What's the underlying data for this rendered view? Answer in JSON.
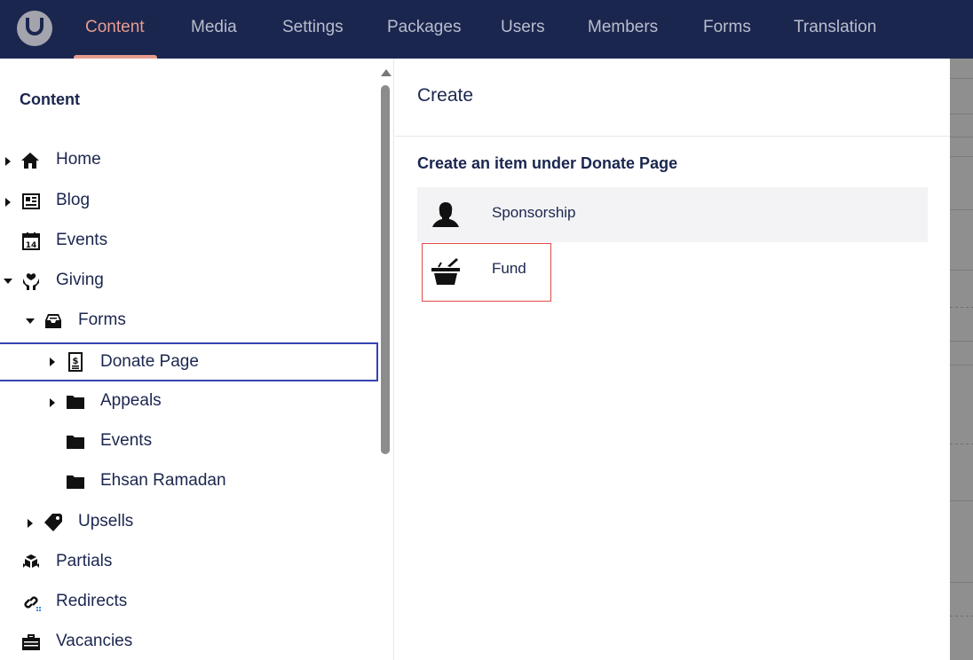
{
  "nav": {
    "logo_icon": "umbraco-logo-icon",
    "items": [
      {
        "label": "Content",
        "active": true
      },
      {
        "label": "Media"
      },
      {
        "label": "Settings"
      },
      {
        "label": "Packages"
      },
      {
        "label": "Users"
      },
      {
        "label": "Members"
      },
      {
        "label": "Forms"
      },
      {
        "label": "Translation"
      }
    ]
  },
  "tree": {
    "heading": "Content",
    "items": [
      {
        "label": "Home",
        "icon": "home-icon",
        "caret": "right"
      },
      {
        "label": "Blog",
        "icon": "newspaper-icon",
        "caret": "right"
      },
      {
        "label": "Events",
        "icon": "calendar-icon",
        "caret": "none"
      },
      {
        "label": "Giving",
        "icon": "hands-heart-icon",
        "caret": "down"
      },
      {
        "label": "Forms",
        "icon": "inbox-icon",
        "caret": "down"
      },
      {
        "label": "Donate Page",
        "icon": "dollar-document-icon",
        "caret": "right",
        "selected": true
      },
      {
        "label": "Appeals",
        "icon": "folder-icon",
        "caret": "right"
      },
      {
        "label": "Events",
        "icon": "folder-icon",
        "caret": "none"
      },
      {
        "label": "Ehsan Ramadan",
        "icon": "folder-icon",
        "caret": "none"
      },
      {
        "label": "Upsells",
        "icon": "tags-icon",
        "caret": "right"
      },
      {
        "label": "Partials",
        "icon": "cubes-icon",
        "caret": "none"
      },
      {
        "label": "Redirects",
        "icon": "link-icon",
        "caret": "none"
      },
      {
        "label": "Vacancies",
        "icon": "briefcase-icon",
        "caret": "none"
      }
    ]
  },
  "create": {
    "title": "Create",
    "subtitle": "Create an item under Donate Page",
    "items": [
      {
        "label": "Sponsorship",
        "icon": "user-female-icon"
      },
      {
        "label": "Fund",
        "icon": "basket-icon"
      }
    ]
  },
  "colors": {
    "topbar": "#1b264f",
    "nav_active": "#e79c8e",
    "nav_inactive": "#b9bdcc",
    "selection_border": "#3544b1",
    "fund_outline": "#e04a4a"
  }
}
